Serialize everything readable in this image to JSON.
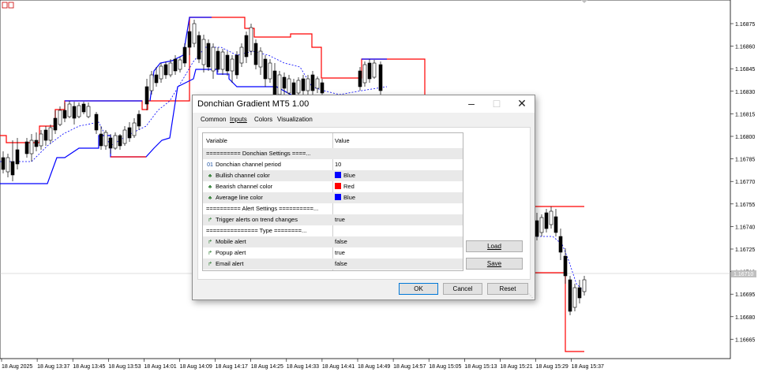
{
  "chart": {
    "price_labels": [
      "1.16875",
      "1.16860",
      "1.16845",
      "1.16830",
      "1.16815",
      "1.16800",
      "1.16785",
      "1.16770",
      "1.16755",
      "1.16740",
      "1.16725",
      "1.16710",
      "1.16695",
      "1.16680",
      "1.16665"
    ],
    "current_price": "1.16710",
    "time_labels": [
      "18 Aug 2025",
      "18 Aug 13:37",
      "18 Aug 13:45",
      "18 Aug 13:53",
      "18 Aug 14:01",
      "18 Aug 14:09",
      "18 Aug 14:17",
      "18 Aug 14:25",
      "18 Aug 14:33",
      "18 Aug 14:41",
      "18 Aug 14:49",
      "18 Aug 14:57",
      "18 Aug 15:05",
      "18 Aug 15:13",
      "18 Aug 15:21",
      "18 Aug 15:29",
      "18 Aug 15:37"
    ],
    "colors": {
      "bullish": "#0000ff",
      "bearish": "#ff0000",
      "average": "#0000ff",
      "candle": "#000000"
    }
  },
  "dialog": {
    "title": "Donchian Gradient MT5 1.00",
    "minimize_icon": "minimize-icon",
    "maximize_icon": "maximize-icon",
    "close_icon": "close-icon",
    "tabs": [
      "Common",
      "Inputs",
      "Colors",
      "Visualization"
    ],
    "active_tab": "Inputs",
    "columns": {
      "variable": "Variable",
      "value": "Value"
    },
    "rows": [
      {
        "variable": "========== Donchian Settings ====...",
        "value": "",
        "icon": "",
        "kind": "separator"
      },
      {
        "variable": "Donchian channel period",
        "value": "10",
        "icon": "01",
        "kind": "number"
      },
      {
        "variable": "Bullish channel color",
        "value": "Blue",
        "icon": "color-palette-icon",
        "color": "#0000ff",
        "kind": "color"
      },
      {
        "variable": "Bearish channel color",
        "value": "Red",
        "icon": "color-palette-icon",
        "color": "#ff0000",
        "kind": "color"
      },
      {
        "variable": "Average line color",
        "value": "Blue",
        "icon": "color-palette-icon",
        "color": "#0000ff",
        "kind": "color"
      },
      {
        "variable": "========== Alert Settings ==========...",
        "value": "",
        "icon": "",
        "kind": "separator"
      },
      {
        "variable": "Trigger alerts on trend changes",
        "value": "true",
        "icon": "bool-flag-icon",
        "kind": "bool"
      },
      {
        "variable": "=============== Type ========...",
        "value": "",
        "icon": "",
        "kind": "separator"
      },
      {
        "variable": "Mobile alert",
        "value": "false",
        "icon": "bool-flag-icon",
        "kind": "bool"
      },
      {
        "variable": "Popup alert",
        "value": "true",
        "icon": "bool-flag-icon",
        "kind": "bool"
      },
      {
        "variable": "Email alert",
        "value": "false",
        "icon": "bool-flag-icon",
        "kind": "bool"
      }
    ],
    "buttons": {
      "load": "Load",
      "save": "Save",
      "ok": "OK",
      "cancel": "Cancel",
      "reset": "Reset"
    }
  }
}
